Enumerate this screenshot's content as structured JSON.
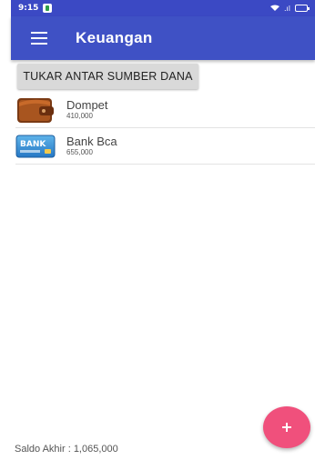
{
  "status_bar": {
    "time": "9:15",
    "signal_icons": "▾ .▐"
  },
  "app_bar": {
    "menu_icon": "menu-icon",
    "title": "Keuangan",
    "color": "#3f51c5"
  },
  "actions": {
    "transfer_label": "TUKAR ANTAR SUMBER DANA"
  },
  "funds": [
    {
      "name": "Dompet",
      "amount": "410,000",
      "icon": "wallet-icon"
    },
    {
      "name": "Bank Bca",
      "amount": "655,000",
      "icon": "bank-card-icon"
    }
  ],
  "bank_card_text": "BANK",
  "footer": {
    "final_balance": "Saldo Akhir : 1,065,000"
  },
  "fab": {
    "icon": "plus-icon",
    "color": "#f0507c"
  }
}
